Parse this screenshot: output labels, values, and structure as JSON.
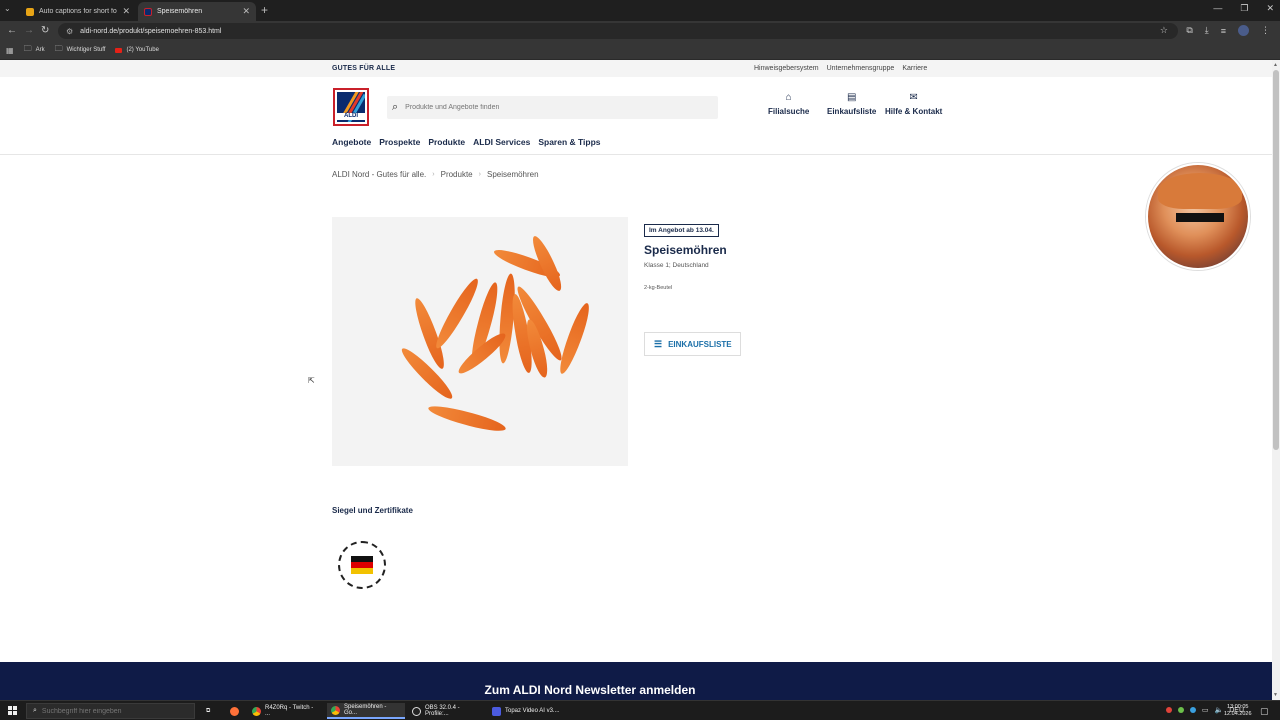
{
  "browser": {
    "tabs": [
      {
        "label": "Auto captions for short form vi"
      },
      {
        "label": "Speisemöhren"
      }
    ],
    "url": "aldi-nord.de/produkt/speisemoehren-853.html",
    "bookmarks": [
      {
        "label": "Ark"
      },
      {
        "label": "Wichtiger Stuff"
      },
      {
        "label": "(2) YouTube"
      }
    ]
  },
  "site": {
    "claim": "GUTES FÜR ALLE",
    "top_links": [
      "Hinweisgebersystem",
      "Unternehmensgruppe",
      "Karriere"
    ],
    "logo_text": "ALDI",
    "search_placeholder": "Produkte und Angebote finden",
    "quick_links": [
      "Filialsuche",
      "Einkaufsliste",
      "Hilfe & Kontakt"
    ],
    "nav": [
      "Angebote",
      "Prospekte",
      "Produkte",
      "ALDI Services",
      "Sparen & Tipps"
    ],
    "breadcrumb": [
      "ALDI Nord - Gutes für alle.",
      "Produkte",
      "Speisemöhren"
    ]
  },
  "product": {
    "badge": "Im Angebot ab 13.04.",
    "title": "Speisemöhren",
    "subtitle": "Klasse 1; Deutschland",
    "unit": "2-kg-Beutel",
    "add_button": "EINKAUFSLISTE"
  },
  "certificates": {
    "title": "Siegel und Zertifikate"
  },
  "newsletter": {
    "title": "Zum ALDI Nord Newsletter anmelden"
  },
  "taskbar": {
    "search_placeholder": "Suchbegriff hier eingeben",
    "apps": [
      {
        "label": "R4Z0Rq - Twitch - ..."
      },
      {
        "label": "Speisemöhren - Go..."
      },
      {
        "label": "OBS 32.0.4 - Profile:..."
      },
      {
        "label": "Topaz Video AI  v3...."
      }
    ],
    "lang": "DEU",
    "time": "13:00:05",
    "date": "12.04.2026"
  },
  "colors": {
    "aldi_blue": "#0a2b6e",
    "aldi_red": "#c9202a",
    "link_blue": "#1b6fa8",
    "newsletter_bg": "#0f1b47"
  }
}
